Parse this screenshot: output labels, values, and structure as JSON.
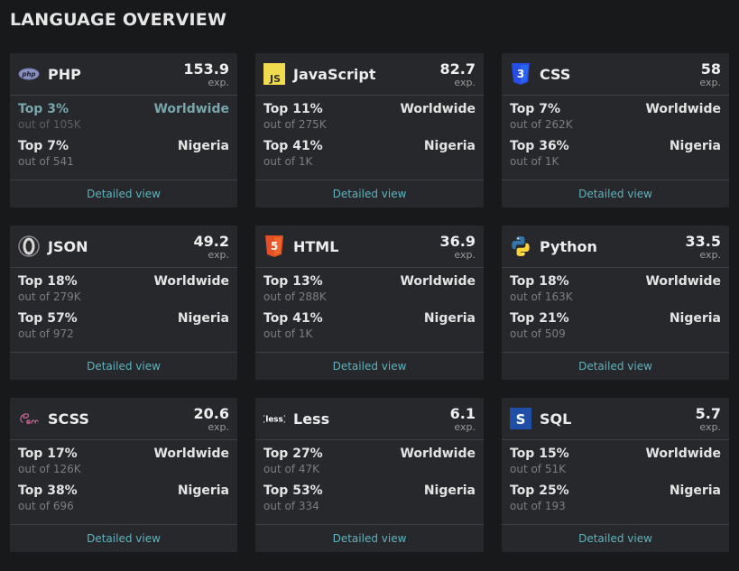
{
  "header": {
    "title": "LANGUAGE OVERVIEW"
  },
  "cards": [
    {
      "icon": "php-icon",
      "name": "PHP",
      "exp": "153.9",
      "exp_label": "exp.",
      "worldwide": {
        "top": "Top 3%",
        "out_of": "out of 105K",
        "region": "Worldwide"
      },
      "country": {
        "top": "Top 7%",
        "out_of": "out of 541",
        "region": "Nigeria"
      },
      "link": "Detailed view"
    },
    {
      "icon": "javascript-icon",
      "name": "JavaScript",
      "exp": "82.7",
      "exp_label": "exp.",
      "worldwide": {
        "top": "Top 11%",
        "out_of": "out of 275K",
        "region": "Worldwide"
      },
      "country": {
        "top": "Top 41%",
        "out_of": "out of 1K",
        "region": "Nigeria"
      },
      "link": "Detailed view"
    },
    {
      "icon": "css-icon",
      "name": "CSS",
      "exp": "58",
      "exp_label": "exp.",
      "worldwide": {
        "top": "Top 7%",
        "out_of": "out of 262K",
        "region": "Worldwide"
      },
      "country": {
        "top": "Top 36%",
        "out_of": "out of 1K",
        "region": "Nigeria"
      },
      "link": "Detailed view"
    },
    {
      "icon": "json-icon",
      "name": "JSON",
      "exp": "49.2",
      "exp_label": "exp.",
      "worldwide": {
        "top": "Top 18%",
        "out_of": "out of 279K",
        "region": "Worldwide"
      },
      "country": {
        "top": "Top 57%",
        "out_of": "out of 972",
        "region": "Nigeria"
      },
      "link": "Detailed view"
    },
    {
      "icon": "html-icon",
      "name": "HTML",
      "exp": "36.9",
      "exp_label": "exp.",
      "worldwide": {
        "top": "Top 13%",
        "out_of": "out of 288K",
        "region": "Worldwide"
      },
      "country": {
        "top": "Top 41%",
        "out_of": "out of 1K",
        "region": "Nigeria"
      },
      "link": "Detailed view"
    },
    {
      "icon": "python-icon",
      "name": "Python",
      "exp": "33.5",
      "exp_label": "exp.",
      "worldwide": {
        "top": "Top 18%",
        "out_of": "out of 163K",
        "region": "Worldwide"
      },
      "country": {
        "top": "Top 21%",
        "out_of": "out of 509",
        "region": "Nigeria"
      },
      "link": "Detailed view"
    },
    {
      "icon": "scss-icon",
      "name": "SCSS",
      "exp": "20.6",
      "exp_label": "exp.",
      "worldwide": {
        "top": "Top 17%",
        "out_of": "out of 126K",
        "region": "Worldwide"
      },
      "country": {
        "top": "Top 38%",
        "out_of": "out of 696",
        "region": "Nigeria"
      },
      "link": "Detailed view"
    },
    {
      "icon": "less-icon",
      "name": "Less",
      "exp": "6.1",
      "exp_label": "exp.",
      "worldwide": {
        "top": "Top 27%",
        "out_of": "out of 47K",
        "region": "Worldwide"
      },
      "country": {
        "top": "Top 53%",
        "out_of": "out of 334",
        "region": "Nigeria"
      },
      "link": "Detailed view"
    },
    {
      "icon": "sql-icon",
      "name": "SQL",
      "exp": "5.7",
      "exp_label": "exp.",
      "worldwide": {
        "top": "Top 15%",
        "out_of": "out of 51K",
        "region": "Worldwide"
      },
      "country": {
        "top": "Top 25%",
        "out_of": "out of 193",
        "region": "Nigeria"
      },
      "link": "Detailed view"
    }
  ],
  "colors": {
    "background": "#18191b",
    "card": "#26282b",
    "link": "#5fb3bf",
    "highlight": "#79a6ab"
  }
}
